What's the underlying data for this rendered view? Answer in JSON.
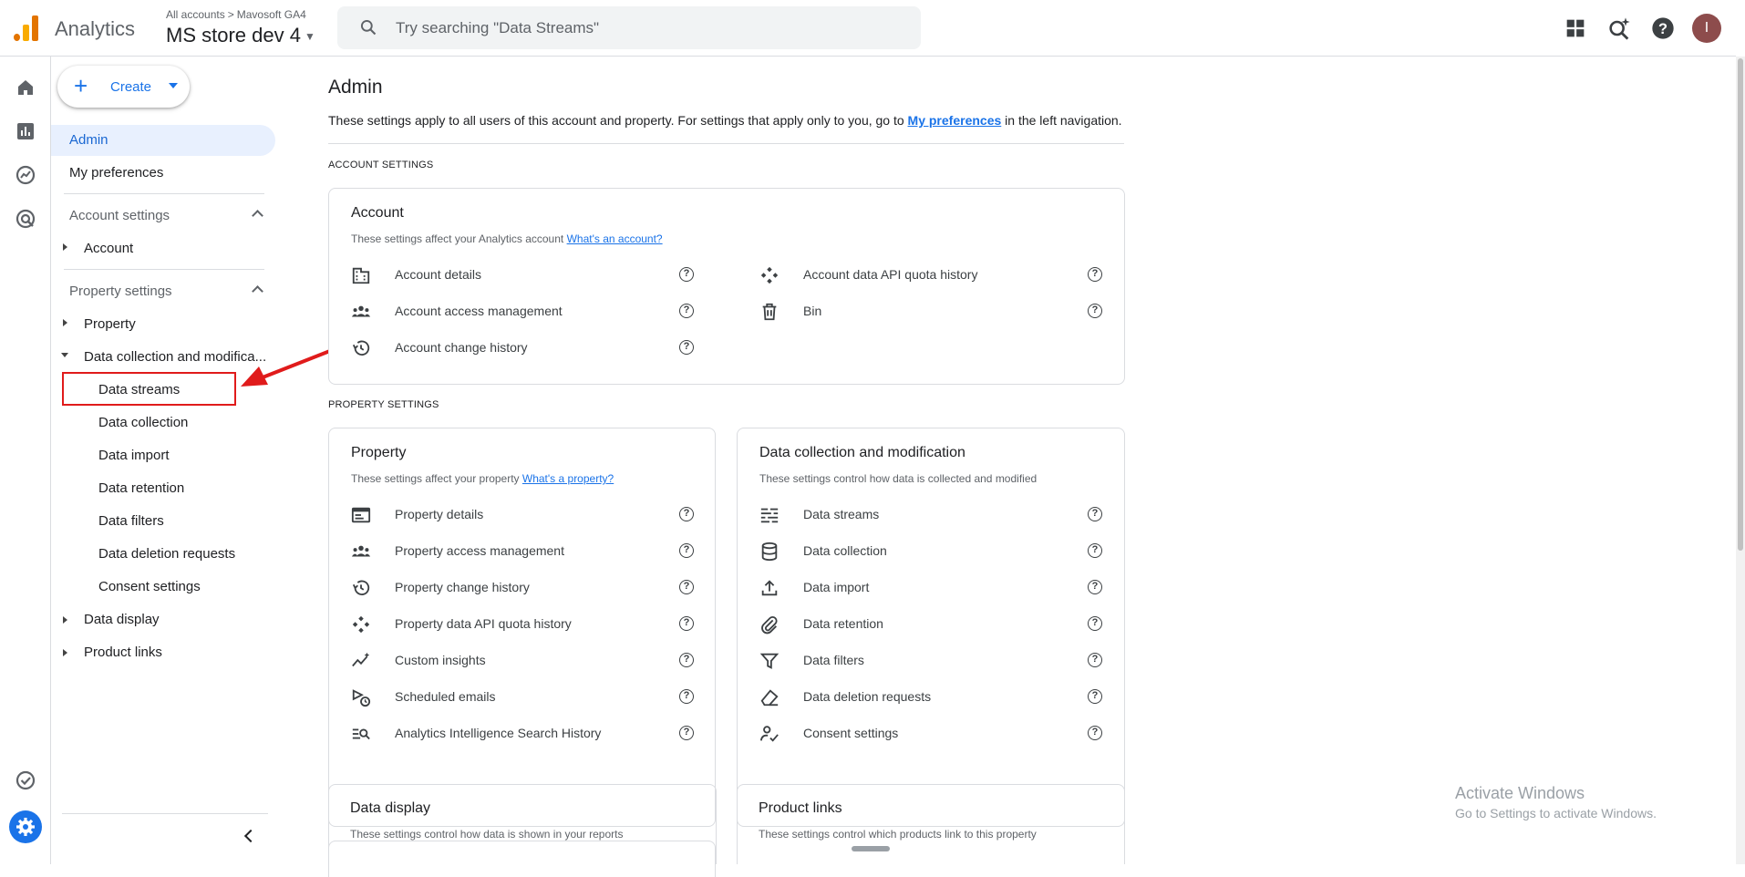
{
  "header": {
    "app_name": "Analytics",
    "breadcrumb_all": "All accounts",
    "breadcrumb_account": "Mavosoft GA4",
    "property": "MS store dev 4",
    "search_placeholder": "Try searching \"Data Streams\"",
    "avatar_letter": "I"
  },
  "sidenav": {
    "create_label": "Create",
    "admin": "Admin",
    "my_preferences": "My preferences",
    "account_settings": "Account settings",
    "account": "Account",
    "property_settings": "Property settings",
    "property": "Property",
    "data_collection_mod": "Data collection and modifica...",
    "sub": [
      "Data streams",
      "Data collection",
      "Data import",
      "Data retention",
      "Data filters",
      "Data deletion requests",
      "Consent settings"
    ],
    "data_display": "Data display",
    "product_links": "Product links"
  },
  "main": {
    "title": "Admin",
    "desc_before": "These settings apply to all users of this account and property. For settings that apply only to you, go to ",
    "desc_link": "My preferences",
    "desc_after": " in the left navigation.",
    "account_section": "ACCOUNT SETTINGS",
    "property_section": "PROPERTY SETTINGS",
    "account_card": {
      "title": "Account",
      "desc": "These settings affect your Analytics account ",
      "link": "What's an account?",
      "left": [
        "Account details",
        "Account access management",
        "Account change history"
      ],
      "right": [
        "Account data API quota history",
        "Bin"
      ]
    },
    "property_card": {
      "title": "Property",
      "desc": "These settings affect your property ",
      "link": "What's a property?",
      "items": [
        "Property details",
        "Property access management",
        "Property change history",
        "Property data API quota history",
        "Custom insights",
        "Scheduled emails",
        "Analytics Intelligence Search History"
      ]
    },
    "dcm_card": {
      "title": "Data collection and modification",
      "desc": "These settings control how data is collected and modified",
      "items": [
        "Data streams",
        "Data collection",
        "Data import",
        "Data retention",
        "Data filters",
        "Data deletion requests",
        "Consent settings"
      ]
    },
    "display_card": {
      "title": "Data display",
      "desc": "These settings control how data is shown in your reports"
    },
    "links_card": {
      "title": "Product links",
      "desc": "These settings control which products link to this property"
    },
    "help_glyph": "?"
  },
  "watermark": {
    "line1": "Activate Windows",
    "line2": "Go to Settings to activate Windows."
  },
  "colors": {
    "accent": "#1a73e8",
    "annotation": "#e01b1b",
    "logo_orange": "#f9ab00",
    "logo_dark": "#e37400"
  }
}
